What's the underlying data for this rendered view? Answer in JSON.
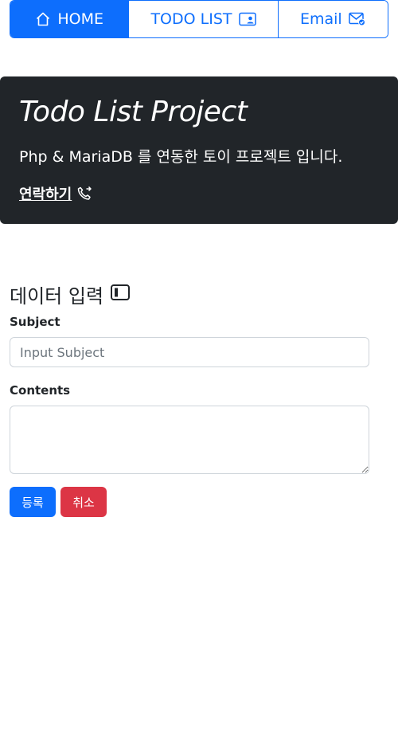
{
  "nav": {
    "home_label": "HOME",
    "home_icon": "house-icon",
    "todo_label": "TODO LIST",
    "todo_icon": "person-video-icon",
    "email_label": "Email",
    "email_icon": "envelope-check-icon",
    "active": "home"
  },
  "hero": {
    "title": "Todo List Project",
    "description": "Php & MariaDB 를 연동한 토이 프로젝트 입니다.",
    "contact_label": "연락하기",
    "contact_icon": "telephone-forward-icon",
    "background": "#212529"
  },
  "form": {
    "section_title": "데이터 입력",
    "section_icon": "layout-sidebar-icon",
    "subject_label": "Subject",
    "subject_placeholder": "Input Subject",
    "subject_value": "",
    "contents_label": "Contents",
    "contents_value": "",
    "submit_label": "등록",
    "cancel_label": "취소"
  },
  "colors": {
    "primary": "#0d6efd",
    "danger": "#dc3545",
    "dark": "#212529"
  }
}
